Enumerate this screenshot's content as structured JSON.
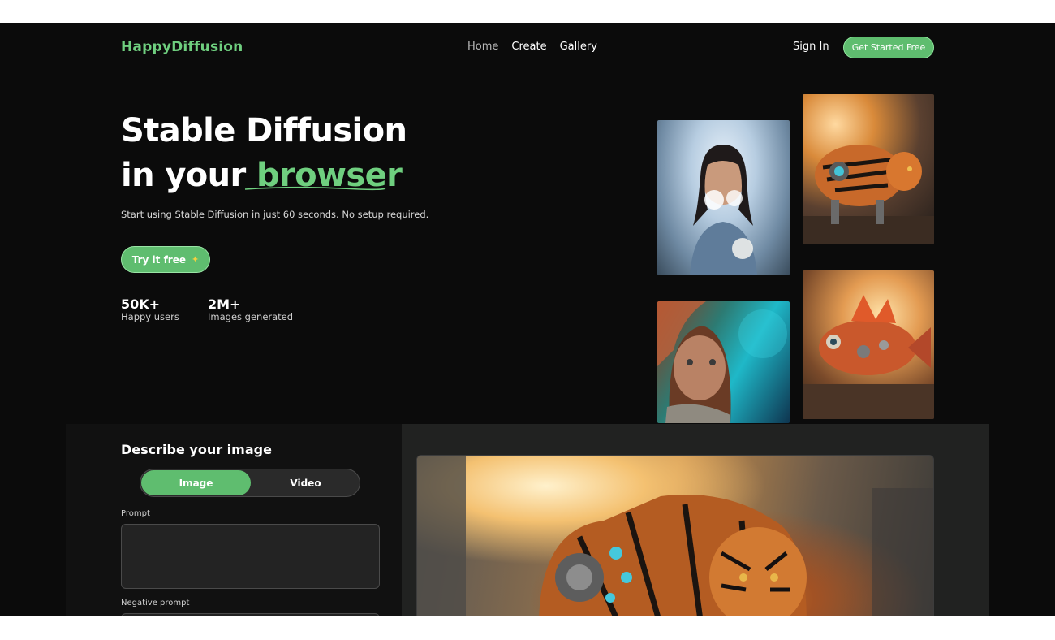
{
  "nav": {
    "logo": "HappyDiffusion",
    "links": [
      {
        "label": "Home",
        "active": true
      },
      {
        "label": "Create",
        "active": false
      },
      {
        "label": "Gallery",
        "active": false
      }
    ],
    "sign_in": "Sign In",
    "cta": "Get Started Free"
  },
  "hero": {
    "title_line1": "Stable Diffusion",
    "title_line2_prefix": "in your ",
    "title_line2_accent": "browser",
    "subtitle": "Start using Stable Diffusion in just 60 seconds. No setup required.",
    "try_button": "Try it free",
    "stats": [
      {
        "value": "50K+",
        "label": "Happy users"
      },
      {
        "value": "2M+",
        "label": "Images generated"
      }
    ]
  },
  "gallery": [
    {
      "id": "woman-flowers-image"
    },
    {
      "id": "robot-tiger-image"
    },
    {
      "id": "fantasy-portrait-image"
    },
    {
      "id": "robot-fish-image"
    }
  ],
  "generator": {
    "title": "Describe your image",
    "modes": [
      "Image",
      "Video"
    ],
    "selected_mode": "Image",
    "prompt_label": "Prompt",
    "prompt_value": "",
    "negative_prompt_label": "Negative prompt"
  },
  "colors": {
    "accent": "#5fbd6f",
    "logo": "#6fcf7f",
    "background": "#0b0b0b"
  }
}
